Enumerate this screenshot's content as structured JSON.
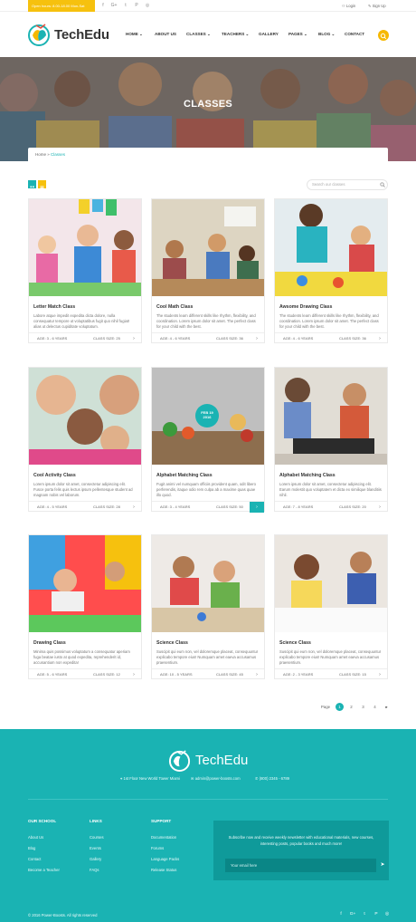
{
  "topbar": {
    "hours": "Open hours: 8.00-18.00 Mon-Sat",
    "social": [
      "f",
      "G+",
      "t",
      "P",
      "◎"
    ],
    "login": "Login",
    "signup": "Sign Up"
  },
  "brand": {
    "name": "TechEdu"
  },
  "menu": [
    "HOME",
    "ABOUT US",
    "CLASSES",
    "TEACHERS",
    "GALLERY",
    "PAGES",
    "BLOG",
    "CONTACT"
  ],
  "hero": {
    "title": "CLASSES"
  },
  "breadcrumb": {
    "home": "Home",
    "current": "Classes"
  },
  "search": {
    "placeholder": "Search our classes"
  },
  "classes": [
    {
      "title": "Letter Match Class",
      "desc": "Labore atque impedit expedita dicta dolore, nulla consequatur tempore ut voluptatibus fugit quo nihil fugiat! alias ut delectus cupiditate voluptatum.",
      "age": "AGE: 3 - 6 YEARS",
      "size": "CLASS SIZE: 25"
    },
    {
      "title": "Cool Math Class",
      "desc": "The students learn different skills like rhythm, flexibility, and coordination. Lorem ipsum dolor sit amet. The perfect class for your child with the best.",
      "age": "AGE: 4 - 6 YEARS",
      "size": "CLASS SIZE: 36"
    },
    {
      "title": "Awsome Drawing Class",
      "desc": "The students learn different skills like rhythm, flexibility, and coordination. Lorem ipsum dolor sit amet. The perfect class for your child with the best.",
      "age": "AGE: 4 - 6 YEARS",
      "size": "CLASS SIZE: 36"
    },
    {
      "title": "Cool Activity Class",
      "desc": "Lorem ipsum dolor sit amet, consectetur adipiscing elit. Fusce porta felis quis lectus ipsum pellentesque student ad magnam nobis vel laborum.",
      "age": "AGE: 4 - 5 YEARS",
      "size": "CLASS SIZE: 28"
    },
    {
      "title": "Alphabet Matching Class",
      "desc": "Fugit animi vel numquam officiis provident quam, odit libero perferendis, itaque odio rem culpa ab a maxime quas quae illo quod.",
      "age": "AGE: 3 - 4 YEARS",
      "size": "CLASS SIZE: 50"
    },
    {
      "title": "Alphabet Matching Class",
      "desc": "Lorem ipsum dolor sit amet, consectetur adipiscing elit. Earum molestit quo voluptatem et dicta ex similique blanditiis nihil.",
      "age": "AGE: 7 - 8 YEARS",
      "size": "CLASS SIZE: 20"
    },
    {
      "title": "Drawing Class",
      "desc": "Minima quis possimus voluptatum a consequatur aperiam fuga beatae iusto at quod expedita, reprehenderit id, accusantium non expedita!",
      "age": "AGE: 5 - 6 YEARS",
      "size": "CLASS SIZE: 12"
    },
    {
      "title": "Science Class",
      "desc": "Suscipit qui eum non, vel doloremque placeat, consequuntur explicabo tempore eius! Numquam amet eaeva accusamus praesentium.",
      "age": "AGE: 10 - 5 YEARS",
      "size": "CLASS SIZE: 45"
    },
    {
      "title": "Science Class",
      "desc": "Suscipit qui eum non, vel doloremque placeat, consequuntur explicabo tempore eius! Numquam amet eaeva accusamus praesentium.",
      "age": "AGE: 2 - 3 YEARS",
      "size": "CLASS SIZE: 15"
    }
  ],
  "date_badge": {
    "month": "FEB 19",
    "year": "2016"
  },
  "pager": {
    "label": "Page",
    "pages": [
      "1",
      "2",
      "3",
      "4"
    ],
    "next": "▸"
  },
  "footer": {
    "address": "1st Floor New World Tower Miami",
    "email": "admin@power-boosts.com",
    "phone": "(800) 2345 - 6789",
    "cols": [
      {
        "title": "OUR SCHOOL",
        "links": [
          "About Us",
          "Blog",
          "Contact",
          "Become a Teacher"
        ]
      },
      {
        "title": "LINKS",
        "links": [
          "Courses",
          "Events",
          "Gallery",
          "FAQs"
        ]
      },
      {
        "title": "SUPPORT",
        "links": [
          "Documentation",
          "Forums",
          "Language Packs",
          "Release Status"
        ]
      }
    ],
    "newsletter_text": "Subscribe now and receive weekly newsletter with educational materials, new courses, interesting posts, popular books and much more!",
    "email_placeholder": "Your email here",
    "copyright": "© 2016 Power-Boosts. All rights reserved",
    "social": [
      "f",
      "G+",
      "t",
      "P",
      "◎"
    ]
  },
  "colors": {
    "accent": "#1ab3b3",
    "yellow": "#f6c10e"
  }
}
